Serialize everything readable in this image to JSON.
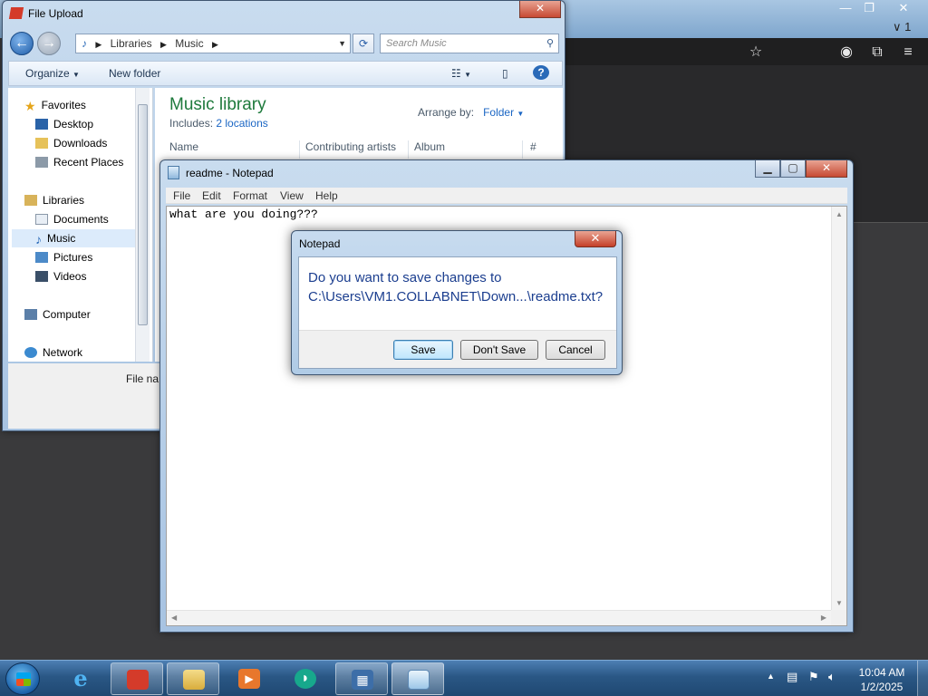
{
  "browser": {
    "tab_count": "1",
    "min": "—",
    "restore": "❐",
    "close": "✕",
    "chevron": "∨"
  },
  "file_upload": {
    "title": "File Upload",
    "address": [
      "Libraries",
      "Music"
    ],
    "search_placeholder": "Search Music",
    "organize": "Organize",
    "new_folder": "New folder",
    "nav": {
      "favorites": "Favorites",
      "desktop": "Desktop",
      "downloads": "Downloads",
      "recent": "Recent Places",
      "libraries": "Libraries",
      "documents": "Documents",
      "music": "Music",
      "pictures": "Pictures",
      "videos": "Videos",
      "computer": "Computer",
      "network": "Network"
    },
    "library_title": "Music library",
    "includes_label": "Includes:",
    "includes_link": "2 locations",
    "arrange_label": "Arrange by:",
    "arrange_value": "Folder",
    "columns": [
      "Name",
      "Contributing artists",
      "Album",
      "#"
    ],
    "file_name_label": "File na"
  },
  "notepad": {
    "title": "readme - Notepad",
    "menu": [
      "File",
      "Edit",
      "Format",
      "View",
      "Help"
    ],
    "content": "what are you doing???"
  },
  "dialog": {
    "title": "Notepad",
    "message_line1": "Do you want to save changes to",
    "message_line2": "C:\\Users\\VM1.COLLABNET\\Down...\\readme.txt?",
    "save": "Save",
    "dont_save": "Don't Save",
    "cancel": "Cancel"
  },
  "taskbar": {
    "time": "10:04 AM",
    "date": "1/2/2025"
  }
}
